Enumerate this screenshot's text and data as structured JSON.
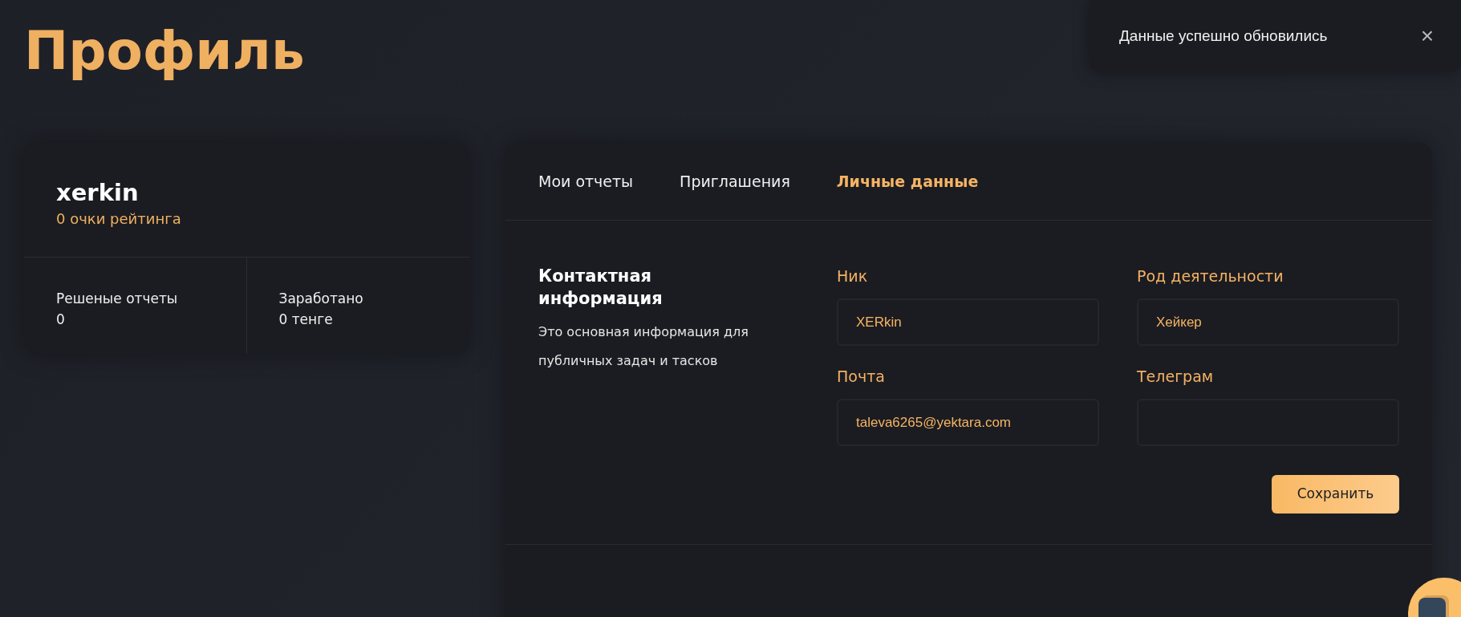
{
  "page_title": "Профиль",
  "toast": {
    "message": "Данные успешно обновились",
    "close": "×"
  },
  "profile": {
    "username": "xerkin",
    "rating": "0 очки рейтинга",
    "stats": [
      {
        "label": "Решеные отчеты",
        "value": "0"
      },
      {
        "label": "Заработано",
        "value": "0 тенге"
      }
    ]
  },
  "tabs": [
    {
      "label": "Мои отчеты",
      "selected": false
    },
    {
      "label": "Приглашения",
      "selected": false
    },
    {
      "label": "Личные данные",
      "selected": true
    }
  ],
  "section": {
    "title": "Контактная информация",
    "description": "Это основная информация для публичных задач и тасков"
  },
  "fields": [
    {
      "label": "Ник",
      "value": "XERkin"
    },
    {
      "label": "Род деятельности",
      "value": "Хейкер"
    },
    {
      "label": "Почта",
      "value": "taleva6265@yektara.com"
    },
    {
      "label": "Телеграм"
    }
  ],
  "save_button": "Сохранить"
}
